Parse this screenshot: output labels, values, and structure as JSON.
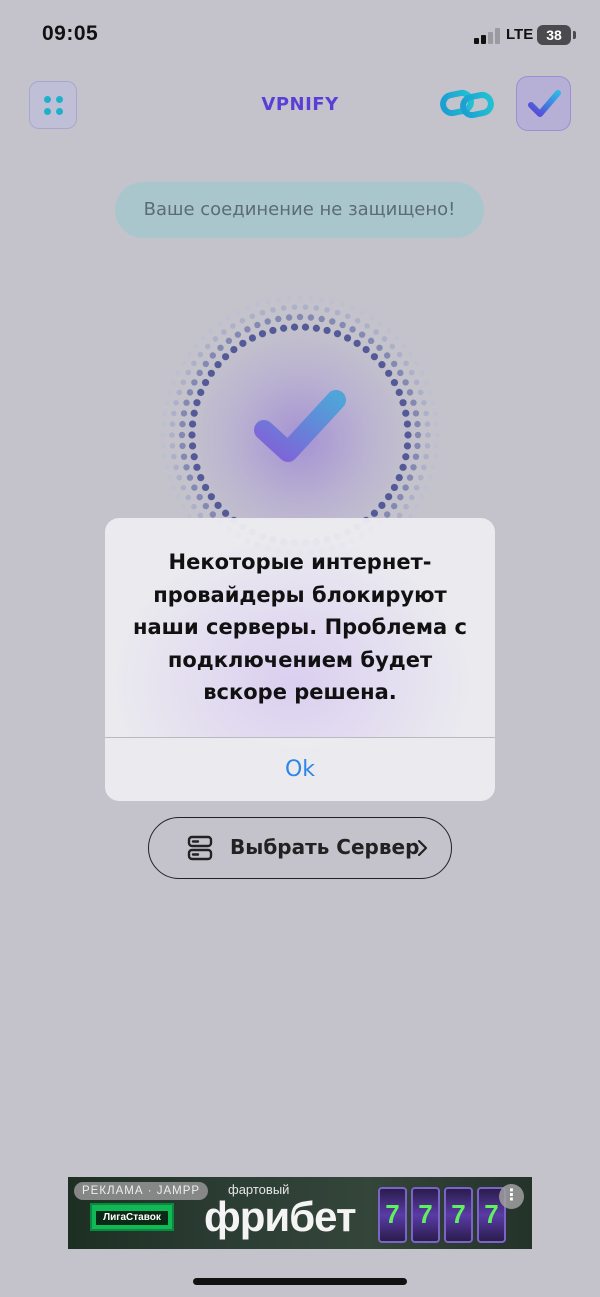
{
  "status_bar": {
    "time": "09:05",
    "network": "LTE",
    "battery": "38"
  },
  "header": {
    "title": "VPNIFY"
  },
  "connection_warning": "Ваше соединение не защищено!",
  "dialog": {
    "message": "Некоторые интернет-провайдеры блокируют наши серверы. Проблема с подключением будет вскоре решена.",
    "ok_label": "Ok"
  },
  "server_button": {
    "label": "Выбрать Сервер"
  },
  "ad": {
    "tag": "РЕКЛАМА · JAMPP",
    "brand": "ЛигаСтавок",
    "subtitle": "фартовый",
    "title": "фрибет",
    "slot_symbol": "7",
    "more": "⋮"
  },
  "colors": {
    "accent": "#5a3fd6",
    "teal": "#1eb2c8",
    "ok_blue": "#2f86e8",
    "background": "#c4c3cc"
  }
}
